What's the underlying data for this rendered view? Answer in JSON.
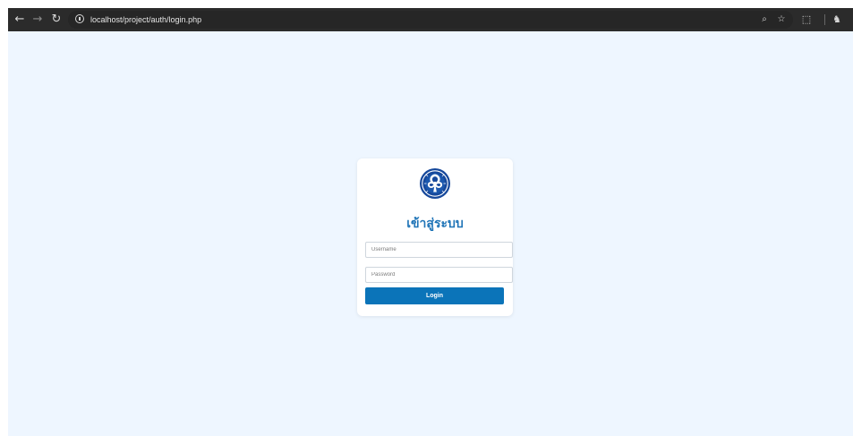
{
  "browser": {
    "url": "localhost/project/auth/login.php",
    "icons": {
      "back": "back-arrow-icon",
      "forward": "forward-arrow-icon",
      "reload": "reload-icon",
      "site_info": "site-info-icon",
      "zoom": "zoom-icon",
      "bookmark": "star-icon",
      "extensions": "extensions-icon",
      "profile": "profile-icon"
    },
    "colors": {
      "toolbar": "#2b2b2b",
      "address_bar": "#262626"
    }
  },
  "login": {
    "logo": "organization-seal-logo",
    "title": "เข้าสู่ระบบ",
    "username_placeholder": "Username",
    "password_placeholder": "Password",
    "button_label": "Login",
    "colors": {
      "page_background": "#eef6ff",
      "card_background": "#ffffff",
      "title": "#1f74b7",
      "button": "#0b74b9",
      "logo": "#16489b"
    }
  }
}
